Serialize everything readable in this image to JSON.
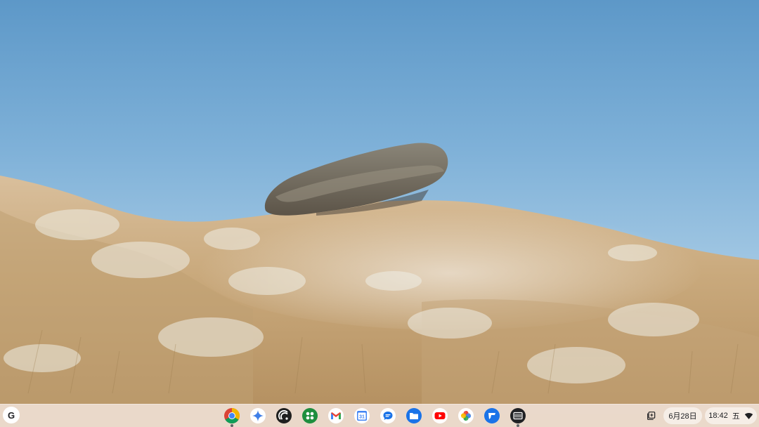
{
  "wallpaper": {
    "description_icon": "landscape-wallpaper"
  },
  "shelf": {
    "launcher_label": "G",
    "apps": [
      {
        "name": "Chrome",
        "icon": "chrome-icon"
      },
      {
        "name": "Gemini",
        "icon": "gemini-icon"
      },
      {
        "name": "Audio",
        "icon": "audio-app-icon"
      },
      {
        "name": "Google Workspace",
        "icon": "workspace-icon"
      },
      {
        "name": "Gmail",
        "icon": "gmail-icon"
      },
      {
        "name": "Calendar",
        "icon": "calendar-icon",
        "label": "31"
      },
      {
        "name": "Messages",
        "icon": "messages-icon"
      },
      {
        "name": "Files",
        "icon": "files-icon"
      },
      {
        "name": "YouTube",
        "icon": "youtube-icon"
      },
      {
        "name": "Photos",
        "icon": "photos-icon"
      },
      {
        "name": "Feedback",
        "icon": "feedback-icon"
      },
      {
        "name": "Terminal",
        "icon": "terminal-icon"
      }
    ],
    "tray": {
      "date": "6月28日",
      "time": "18:42",
      "weekday": "五"
    }
  }
}
